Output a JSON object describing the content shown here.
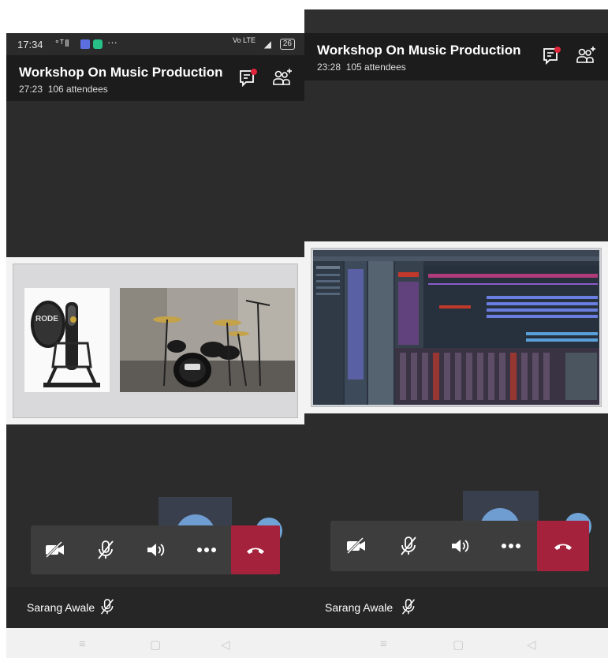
{
  "left": {
    "status": {
      "time": "17:34",
      "signal": "°ᵀⅡ",
      "dots": "···",
      "volte": "Vo LTE",
      "battery": "26"
    },
    "header": {
      "title": "Workshop On Music Production",
      "duration": "27:23",
      "attendees": "106 attendees"
    },
    "participant": {
      "name": "Sarang Awale"
    }
  },
  "right": {
    "header": {
      "title": "Workshop On Music Production",
      "duration": "23:28",
      "attendees": "105 attendees"
    },
    "participant": {
      "name": "Sarang Awale"
    }
  },
  "colors": {
    "hangup": "#a5223d",
    "header_bg": "#1c1c1c",
    "stage_bg": "#2c2c2c",
    "avatar": "#6f9dd1"
  },
  "icons": {
    "controls": [
      "camera-off-icon",
      "mic-off-icon",
      "speaker-icon",
      "more-icon",
      "hang-up-icon"
    ],
    "header": [
      "chat-icon",
      "add-people-icon"
    ]
  }
}
